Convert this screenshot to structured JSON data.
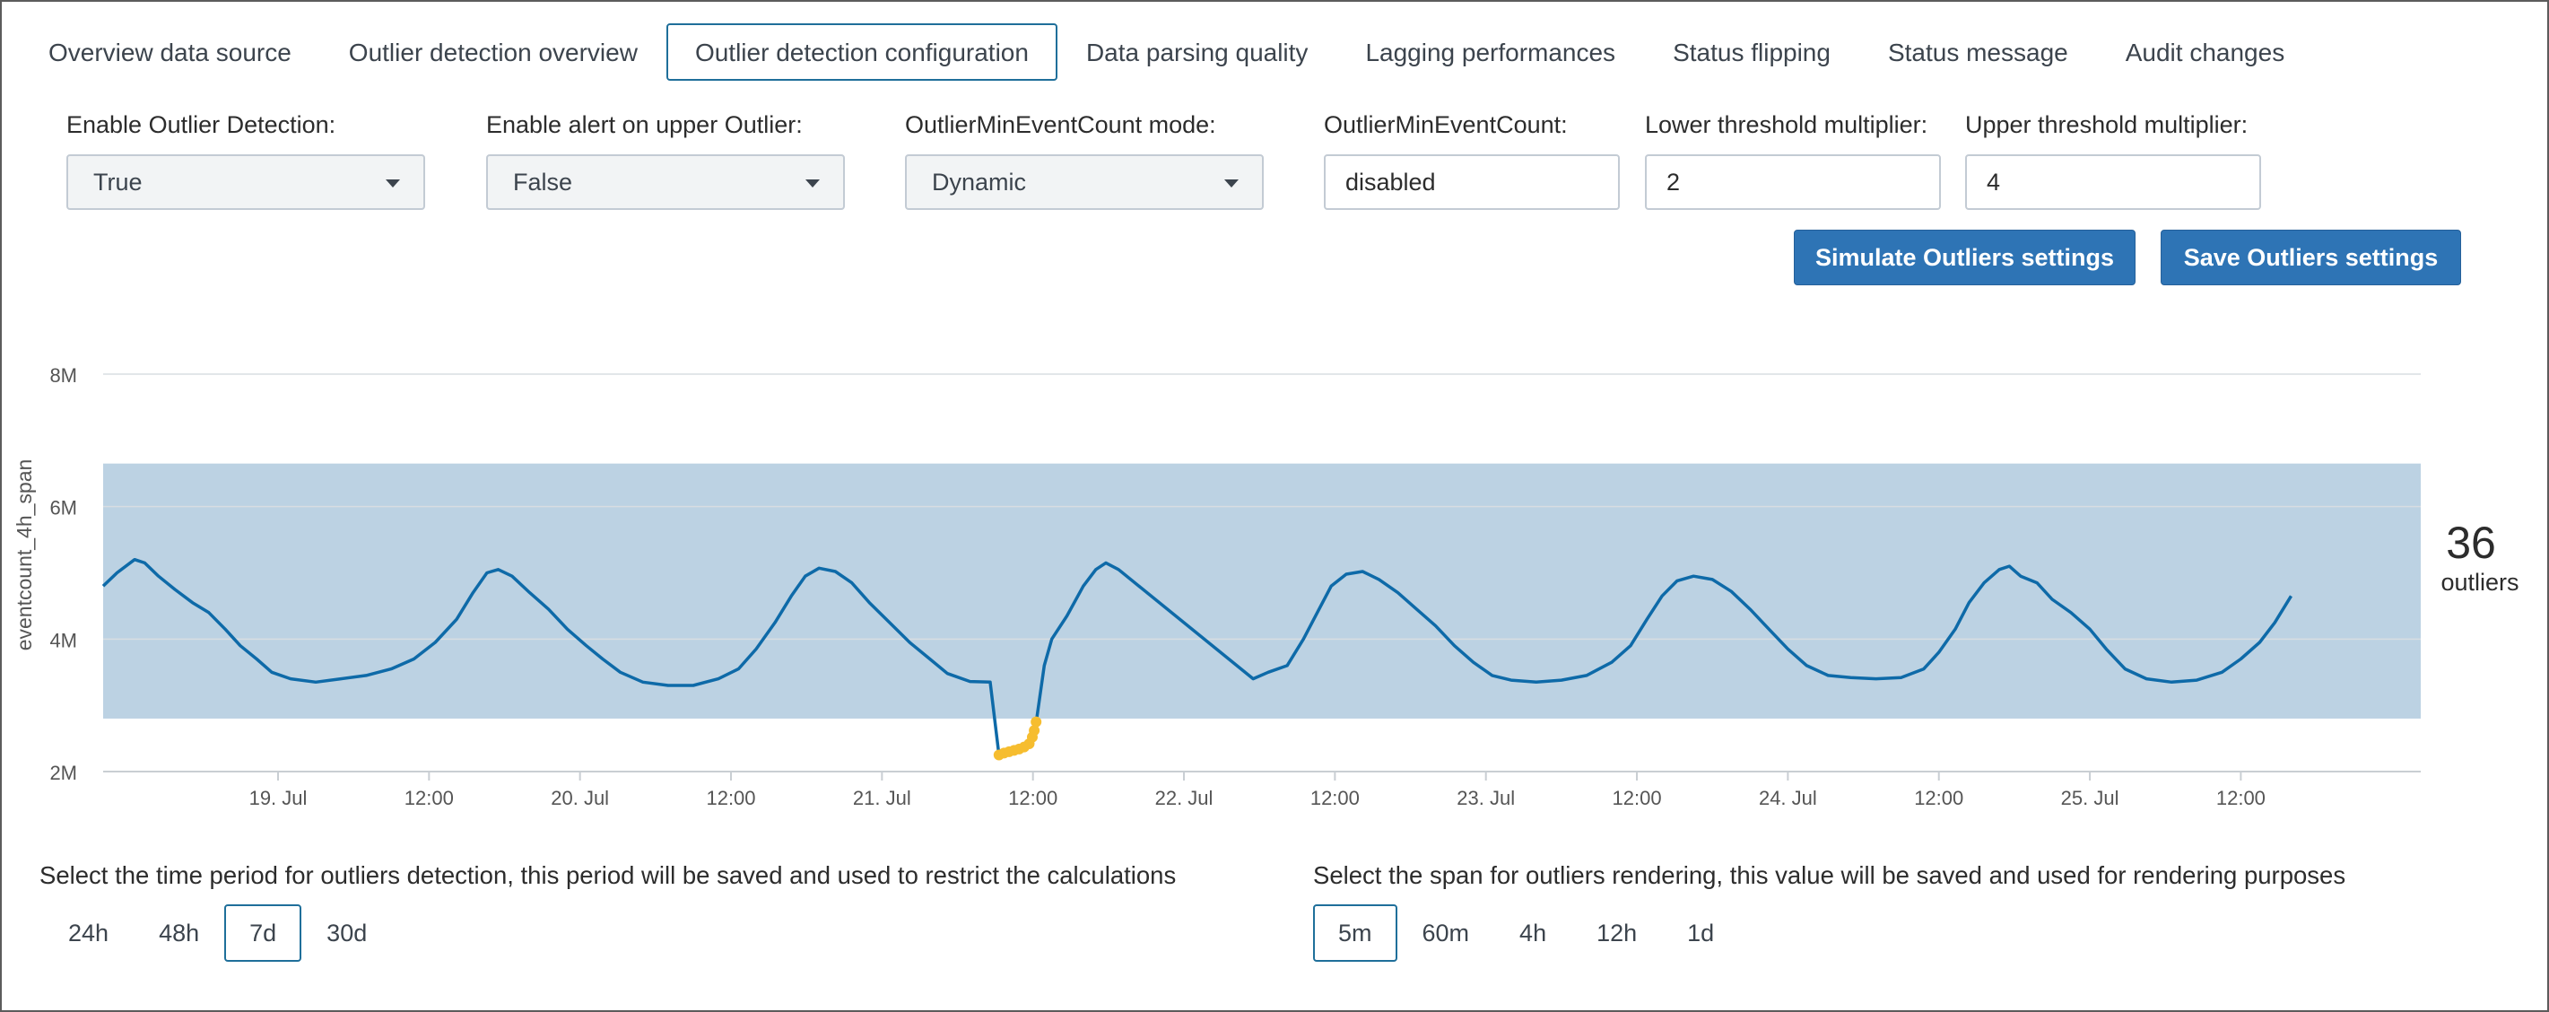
{
  "tabs": [
    {
      "label": "Overview data source",
      "active": false
    },
    {
      "label": "Outlier detection overview",
      "active": false
    },
    {
      "label": "Outlier detection configuration",
      "active": true
    },
    {
      "label": "Data parsing quality",
      "active": false
    },
    {
      "label": "Lagging performances",
      "active": false
    },
    {
      "label": "Status flipping",
      "active": false
    },
    {
      "label": "Status message",
      "active": false
    },
    {
      "label": "Audit changes",
      "active": false
    }
  ],
  "form": {
    "enable_outlier": {
      "label": "Enable Outlier Detection:",
      "value": "True"
    },
    "enable_alert_upper": {
      "label": "Enable alert on upper Outlier:",
      "value": "False"
    },
    "min_event_mode": {
      "label": "OutlierMinEventCount mode:",
      "value": "Dynamic"
    },
    "min_event_count": {
      "label": "OutlierMinEventCount:",
      "value": "disabled"
    },
    "lower_multiplier": {
      "label": "Lower threshold multiplier:",
      "value": "2"
    },
    "upper_multiplier": {
      "label": "Upper threshold multiplier:",
      "value": "4"
    }
  },
  "buttons": {
    "simulate": "Simulate Outliers settings",
    "save": "Save Outliers settings"
  },
  "colors": {
    "accent": "#2e74b5",
    "series": "#0e6aa8",
    "band": "#bcd2e3",
    "outlier": "#f6bd2f"
  },
  "chart_data": {
    "type": "area",
    "ylabel": "eventcount_4h_span",
    "y_ticks": [
      "2M",
      "4M",
      "6M",
      "8M"
    ],
    "ylim": [
      2000000,
      8000000
    ],
    "x_ticks": [
      "19. Jul",
      "12:00",
      "20. Jul",
      "12:00",
      "21. Jul",
      "12:00",
      "22. Jul",
      "12:00",
      "23. Jul",
      "12:00",
      "24. Jul",
      "12:00",
      "25. Jul",
      "12:00"
    ],
    "x_tick_hours": [
      24,
      36,
      48,
      60,
      72,
      84,
      96,
      108,
      120,
      132,
      144,
      156,
      168,
      180
    ],
    "xlim_hours": [
      10.1,
      194.3
    ],
    "band": {
      "lower": 2800000,
      "upper": 6650000
    },
    "grid": true,
    "series": [
      {
        "name": "eventcount_4h_span",
        "points": [
          [
            10.1,
            4.8
          ],
          [
            11.2,
            5.0
          ],
          [
            12.6,
            5.2
          ],
          [
            13.4,
            5.15
          ],
          [
            14.5,
            4.95
          ],
          [
            15.8,
            4.75
          ],
          [
            17.2,
            4.55
          ],
          [
            18.5,
            4.4
          ],
          [
            19.8,
            4.15
          ],
          [
            21.0,
            3.9
          ],
          [
            22.3,
            3.7
          ],
          [
            23.5,
            3.5
          ],
          [
            25.0,
            3.4
          ],
          [
            27.0,
            3.35
          ],
          [
            29.0,
            3.4
          ],
          [
            31.0,
            3.45
          ],
          [
            33.0,
            3.55
          ],
          [
            34.8,
            3.7
          ],
          [
            36.5,
            3.95
          ],
          [
            38.2,
            4.3
          ],
          [
            39.5,
            4.7
          ],
          [
            40.6,
            5.0
          ],
          [
            41.5,
            5.05
          ],
          [
            42.6,
            4.95
          ],
          [
            44.0,
            4.7
          ],
          [
            45.5,
            4.45
          ],
          [
            47.0,
            4.15
          ],
          [
            48.5,
            3.9
          ],
          [
            49.8,
            3.7
          ],
          [
            51.2,
            3.5
          ],
          [
            53.0,
            3.35
          ],
          [
            55.0,
            3.3
          ],
          [
            57.0,
            3.3
          ],
          [
            59.0,
            3.4
          ],
          [
            60.6,
            3.55
          ],
          [
            62.0,
            3.85
          ],
          [
            63.5,
            4.25
          ],
          [
            64.8,
            4.65
          ],
          [
            65.9,
            4.95
          ],
          [
            67.0,
            5.07
          ],
          [
            68.3,
            5.02
          ],
          [
            69.6,
            4.85
          ],
          [
            71.0,
            4.55
          ],
          [
            72.6,
            4.25
          ],
          [
            74.2,
            3.95
          ],
          [
            75.8,
            3.7
          ],
          [
            77.2,
            3.48
          ],
          [
            79.0,
            3.36
          ],
          [
            80.6,
            3.35
          ],
          [
            81.3,
            2.25
          ],
          [
            82.3,
            2.35
          ],
          [
            83.8,
            2.45
          ],
          [
            84.3,
            2.8
          ],
          [
            84.9,
            3.6
          ],
          [
            85.5,
            4.0
          ],
          [
            86.7,
            4.35
          ],
          [
            88.0,
            4.8
          ],
          [
            89.0,
            5.05
          ],
          [
            89.8,
            5.15
          ],
          [
            90.8,
            5.05
          ],
          [
            101.5,
            3.4
          ],
          [
            102.7,
            3.5
          ],
          [
            104.2,
            3.6
          ],
          [
            105.5,
            4.0
          ],
          [
            106.6,
            4.4
          ],
          [
            107.7,
            4.8
          ],
          [
            108.9,
            4.98
          ],
          [
            110.2,
            5.02
          ],
          [
            111.5,
            4.9
          ],
          [
            113.0,
            4.7
          ],
          [
            114.5,
            4.45
          ],
          [
            116.0,
            4.2
          ],
          [
            117.5,
            3.9
          ],
          [
            119.0,
            3.65
          ],
          [
            120.5,
            3.45
          ],
          [
            122.0,
            3.38
          ],
          [
            124.0,
            3.35
          ],
          [
            126.0,
            3.38
          ],
          [
            128.0,
            3.45
          ],
          [
            130.0,
            3.65
          ],
          [
            131.5,
            3.9
          ],
          [
            132.8,
            4.3
          ],
          [
            134.0,
            4.65
          ],
          [
            135.2,
            4.88
          ],
          [
            136.5,
            4.95
          ],
          [
            138.0,
            4.9
          ],
          [
            139.5,
            4.72
          ],
          [
            141.0,
            4.45
          ],
          [
            142.5,
            4.15
          ],
          [
            144.0,
            3.85
          ],
          [
            145.5,
            3.6
          ],
          [
            147.2,
            3.45
          ],
          [
            149.0,
            3.42
          ],
          [
            151.0,
            3.4
          ],
          [
            153.0,
            3.42
          ],
          [
            154.8,
            3.55
          ],
          [
            156.0,
            3.8
          ],
          [
            157.3,
            4.15
          ],
          [
            158.4,
            4.55
          ],
          [
            159.6,
            4.85
          ],
          [
            160.8,
            5.05
          ],
          [
            161.6,
            5.1
          ],
          [
            162.5,
            4.95
          ],
          [
            163.8,
            4.85
          ],
          [
            165.0,
            4.6
          ],
          [
            166.5,
            4.4
          ],
          [
            168.0,
            4.15
          ],
          [
            169.3,
            3.85
          ],
          [
            170.8,
            3.55
          ],
          [
            172.5,
            3.4
          ],
          [
            174.5,
            3.35
          ],
          [
            176.5,
            3.38
          ],
          [
            178.5,
            3.5
          ],
          [
            180.0,
            3.7
          ],
          [
            181.5,
            3.95
          ],
          [
            182.7,
            4.25
          ],
          [
            184.0,
            4.65
          ]
        ]
      }
    ],
    "outliers": {
      "name": "outliers",
      "count": "36",
      "label": "outliers",
      "points": [
        [
          81.3,
          2.25
        ],
        [
          81.7,
          2.28
        ],
        [
          82.1,
          2.3
        ],
        [
          82.5,
          2.32
        ],
        [
          82.9,
          2.34
        ],
        [
          83.3,
          2.37
        ],
        [
          83.7,
          2.42
        ],
        [
          83.95,
          2.52
        ],
        [
          84.1,
          2.62
        ],
        [
          84.25,
          2.75
        ]
      ]
    }
  },
  "period": {
    "description": "Select the time period for outliers detection, this period will be saved and used to restrict the calculations",
    "options": [
      {
        "label": "24h",
        "active": false
      },
      {
        "label": "48h",
        "active": false
      },
      {
        "label": "7d",
        "active": true
      },
      {
        "label": "30d",
        "active": false
      }
    ]
  },
  "span": {
    "description": "Select the span for outliers rendering, this value will be saved and used for rendering purposes",
    "options": [
      {
        "label": "5m",
        "active": true
      },
      {
        "label": "60m",
        "active": false
      },
      {
        "label": "4h",
        "active": false
      },
      {
        "label": "12h",
        "active": false
      },
      {
        "label": "1d",
        "active": false
      }
    ]
  }
}
